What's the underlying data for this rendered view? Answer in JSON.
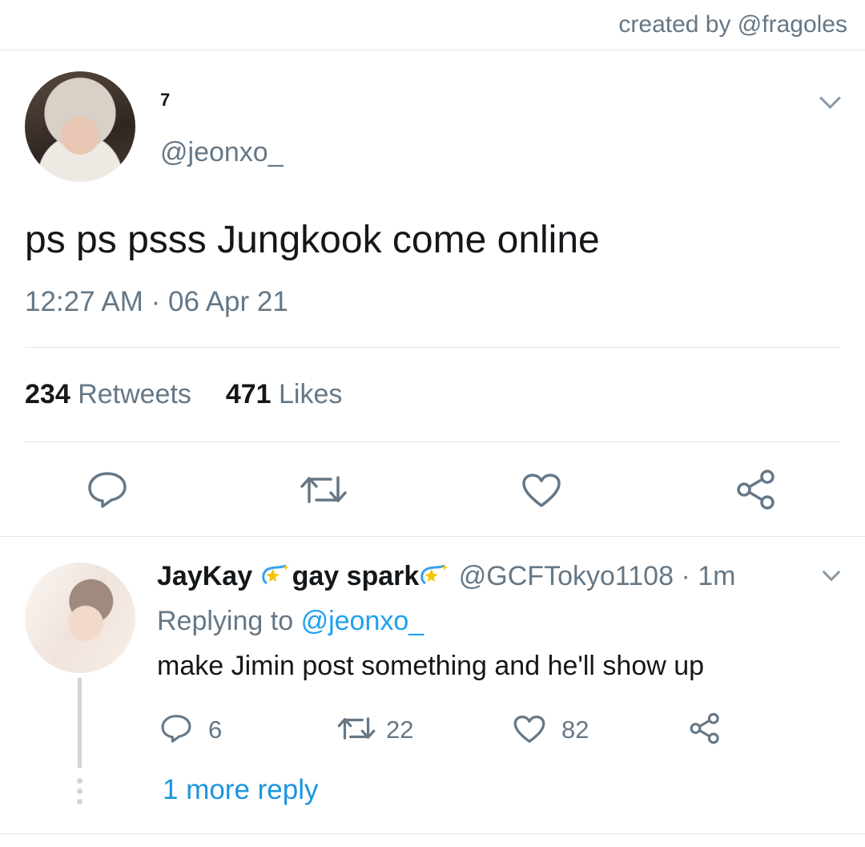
{
  "credit": "created by @fragoles",
  "tweet": {
    "name": "7",
    "handle": "@jeonxo_",
    "text": "ps ps psss Jungkook come online",
    "timestamp": "12:27 AM · 06 Apr 21",
    "retweets_count": "234",
    "retweets_label": "Retweets",
    "likes_count": "471",
    "likes_label": "Likes"
  },
  "reply": {
    "name_part1": "JayKay",
    "name_part2": "gay spark",
    "handle_time": "@GCFTokyo1108 · 1m",
    "replying_prefix": "Replying to",
    "replying_to": "@jeonxo_",
    "text": "make Jimin post something and he'll show up",
    "reply_count": "6",
    "retweet_count": "22",
    "like_count": "82",
    "more_replies": "1 more reply"
  },
  "colors": {
    "link": "#1da1f2",
    "muted": "#657786",
    "divider": "#e1e8ed",
    "text": "#14171a"
  },
  "icons": [
    "chevron-down-icon",
    "reply-icon",
    "retweet-icon",
    "heart-icon",
    "share-icon",
    "sparkle-emoji"
  ]
}
